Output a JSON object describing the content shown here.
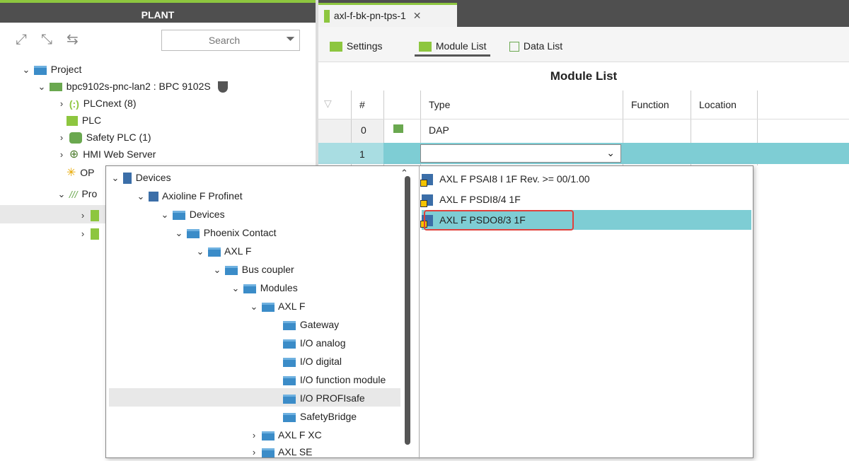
{
  "left_panel": {
    "title": "PLANT",
    "search_placeholder": "Search",
    "tree": [
      {
        "label": "Project"
      },
      {
        "label": "bpc9102s-pnc-lan2 : BPC 9102S"
      },
      {
        "label": "PLCnext (8)"
      },
      {
        "label": "PLC"
      },
      {
        "label": "Safety PLC (1)"
      },
      {
        "label": "HMI Web Server"
      },
      {
        "label": "OP"
      },
      {
        "label": "Pro"
      }
    ]
  },
  "editor": {
    "tab_label": "axl-f-bk-pn-tps-1",
    "subtabs": {
      "settings": "Settings",
      "module_list": "Module List",
      "data_list": "Data List"
    },
    "title": "Module List",
    "columns": {
      "num": "#",
      "type": "Type",
      "function": "Function",
      "location": "Location"
    },
    "rows": [
      {
        "num": "0",
        "type": "DAP"
      },
      {
        "num": "1",
        "type": ""
      }
    ]
  },
  "dropdown": {
    "tree": [
      {
        "label": "Devices"
      },
      {
        "label": "Axioline F Profinet"
      },
      {
        "label": "Devices"
      },
      {
        "label": "Phoenix Contact"
      },
      {
        "label": "AXL F"
      },
      {
        "label": "Bus coupler"
      },
      {
        "label": "Modules"
      },
      {
        "label": "AXL F"
      },
      {
        "label": "Gateway"
      },
      {
        "label": "I/O analog"
      },
      {
        "label": "I/O digital"
      },
      {
        "label": "I/O function module"
      },
      {
        "label": "I/O PROFIsafe"
      },
      {
        "label": "SafetyBridge"
      },
      {
        "label": "AXL F XC"
      },
      {
        "label": "AXL SE"
      }
    ],
    "modules": [
      {
        "label": "AXL F PSAI8 I 1F Rev. >= 00/1.00"
      },
      {
        "label": "AXL F PSDI8/4 1F"
      },
      {
        "label": "AXL F PSDO8/3 1F"
      }
    ]
  },
  "colors": {
    "accent": "#8dc63f",
    "selection": "#7ecdd4",
    "highlight": "#e0413c",
    "header": "#4f4f4f"
  }
}
